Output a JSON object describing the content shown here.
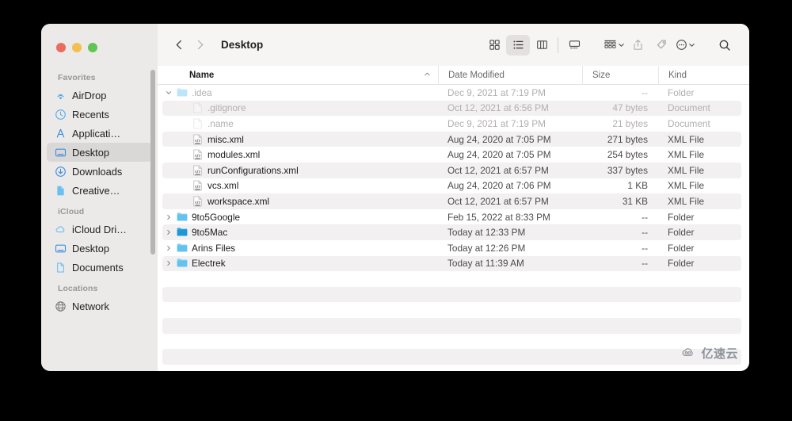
{
  "window": {
    "title": "Desktop",
    "traffic_lights": [
      "close-red",
      "minimize-yellow",
      "maximize-green"
    ]
  },
  "toolbar": {
    "back_label": "Back",
    "forward_label": "Forward",
    "view_icon_label": "Icon View",
    "view_list_label": "List View",
    "view_column_label": "Column View",
    "view_gallery_label": "Gallery View",
    "group_label": "Group",
    "share_label": "Share",
    "tags_label": "Tags",
    "more_label": "More",
    "search_label": "Search",
    "active_view": "list"
  },
  "sidebar": {
    "sections": [
      {
        "title": "Favorites",
        "items": [
          {
            "label": "AirDrop",
            "icon": "airdrop-icon",
            "selected": false
          },
          {
            "label": "Recents",
            "icon": "clock-icon",
            "selected": false
          },
          {
            "label": "Applicati…",
            "icon": "applications-icon",
            "selected": false
          },
          {
            "label": "Desktop",
            "icon": "desktop-icon",
            "selected": true
          },
          {
            "label": "Downloads",
            "icon": "downloads-icon",
            "selected": false
          },
          {
            "label": "Creative…",
            "icon": "document-icon",
            "selected": false
          }
        ]
      },
      {
        "title": "iCloud",
        "items": [
          {
            "label": "iCloud Dri…",
            "icon": "cloud-icon",
            "selected": false
          },
          {
            "label": "Desktop",
            "icon": "desktop-icon",
            "selected": false
          },
          {
            "label": "Documents",
            "icon": "document-icon",
            "selected": false
          }
        ]
      },
      {
        "title": "Locations",
        "items": [
          {
            "label": "Network",
            "icon": "globe-icon",
            "selected": false
          }
        ]
      }
    ]
  },
  "columns": {
    "name": "Name",
    "date_modified": "Date Modified",
    "size": "Size",
    "kind": "Kind",
    "sorted_by": "Name",
    "sort_direction": "ascending"
  },
  "files": [
    {
      "name": ".idea",
      "date": "Dec 9, 2021 at 7:19 PM",
      "size": "--",
      "kind": "Folder",
      "icon": "folder-icon",
      "indent": 0,
      "twisty": "expanded",
      "dim": true,
      "alt": false
    },
    {
      "name": ".gitignore",
      "date": "Oct 12, 2021 at 6:56 PM",
      "size": "47 bytes",
      "kind": "Document",
      "icon": "document-icon",
      "indent": 1,
      "twisty": "none",
      "dim": true,
      "alt": true
    },
    {
      "name": ".name",
      "date": "Dec 9, 2021 at 7:19 PM",
      "size": "21 bytes",
      "kind": "Document",
      "icon": "document-icon",
      "indent": 1,
      "twisty": "none",
      "dim": true,
      "alt": false
    },
    {
      "name": "misc.xml",
      "date": "Aug 24, 2020 at 7:05 PM",
      "size": "271 bytes",
      "kind": "XML File",
      "icon": "xml-file-icon",
      "indent": 1,
      "twisty": "none",
      "dim": false,
      "alt": true
    },
    {
      "name": "modules.xml",
      "date": "Aug 24, 2020 at 7:05 PM",
      "size": "254 bytes",
      "kind": "XML File",
      "icon": "xml-file-icon",
      "indent": 1,
      "twisty": "none",
      "dim": false,
      "alt": false
    },
    {
      "name": "runConfigurations.xml",
      "date": "Oct 12, 2021 at 6:57 PM",
      "size": "337 bytes",
      "kind": "XML File",
      "icon": "xml-file-icon",
      "indent": 1,
      "twisty": "none",
      "dim": false,
      "alt": true
    },
    {
      "name": "vcs.xml",
      "date": "Aug 24, 2020 at 7:06 PM",
      "size": "1 KB",
      "kind": "XML File",
      "icon": "xml-file-icon",
      "indent": 1,
      "twisty": "none",
      "dim": false,
      "alt": false
    },
    {
      "name": "workspace.xml",
      "date": "Oct 12, 2021 at 6:57 PM",
      "size": "31 KB",
      "kind": "XML File",
      "icon": "xml-file-icon",
      "indent": 1,
      "twisty": "none",
      "dim": false,
      "alt": true
    },
    {
      "name": "9to5Google",
      "date": "Feb 15, 2022 at 8:33 PM",
      "size": "--",
      "kind": "Folder",
      "icon": "folder-icon",
      "indent": 0,
      "twisty": "collapsed",
      "dim": false,
      "alt": false
    },
    {
      "name": "9to5Mac",
      "date": "Today at 12:33 PM",
      "size": "--",
      "kind": "Folder",
      "icon": "folder-solid-icon",
      "indent": 0,
      "twisty": "collapsed",
      "dim": false,
      "alt": true
    },
    {
      "name": "Arins Files",
      "date": "Today at 12:26 PM",
      "size": "--",
      "kind": "Folder",
      "icon": "folder-icon",
      "indent": 0,
      "twisty": "collapsed",
      "dim": false,
      "alt": false
    },
    {
      "name": "Electrek",
      "date": "Today at 11:39 AM",
      "size": "--",
      "kind": "Folder",
      "icon": "folder-icon",
      "indent": 0,
      "twisty": "collapsed",
      "dim": false,
      "alt": true
    }
  ],
  "empty_row_count": 6,
  "watermark": {
    "text": "亿速云"
  },
  "colors": {
    "sidebar_bg": "#ece9e9",
    "toolbar_bg": "#f7f4f4",
    "content_bg": "#ffffff",
    "row_alt": "#f2f0f0",
    "folder_blue": "#5bc4f1",
    "folder_solid_blue": "#34ade4",
    "accent_blue": "#2f7fd8",
    "selected_sidebar": "#dad7d7"
  }
}
